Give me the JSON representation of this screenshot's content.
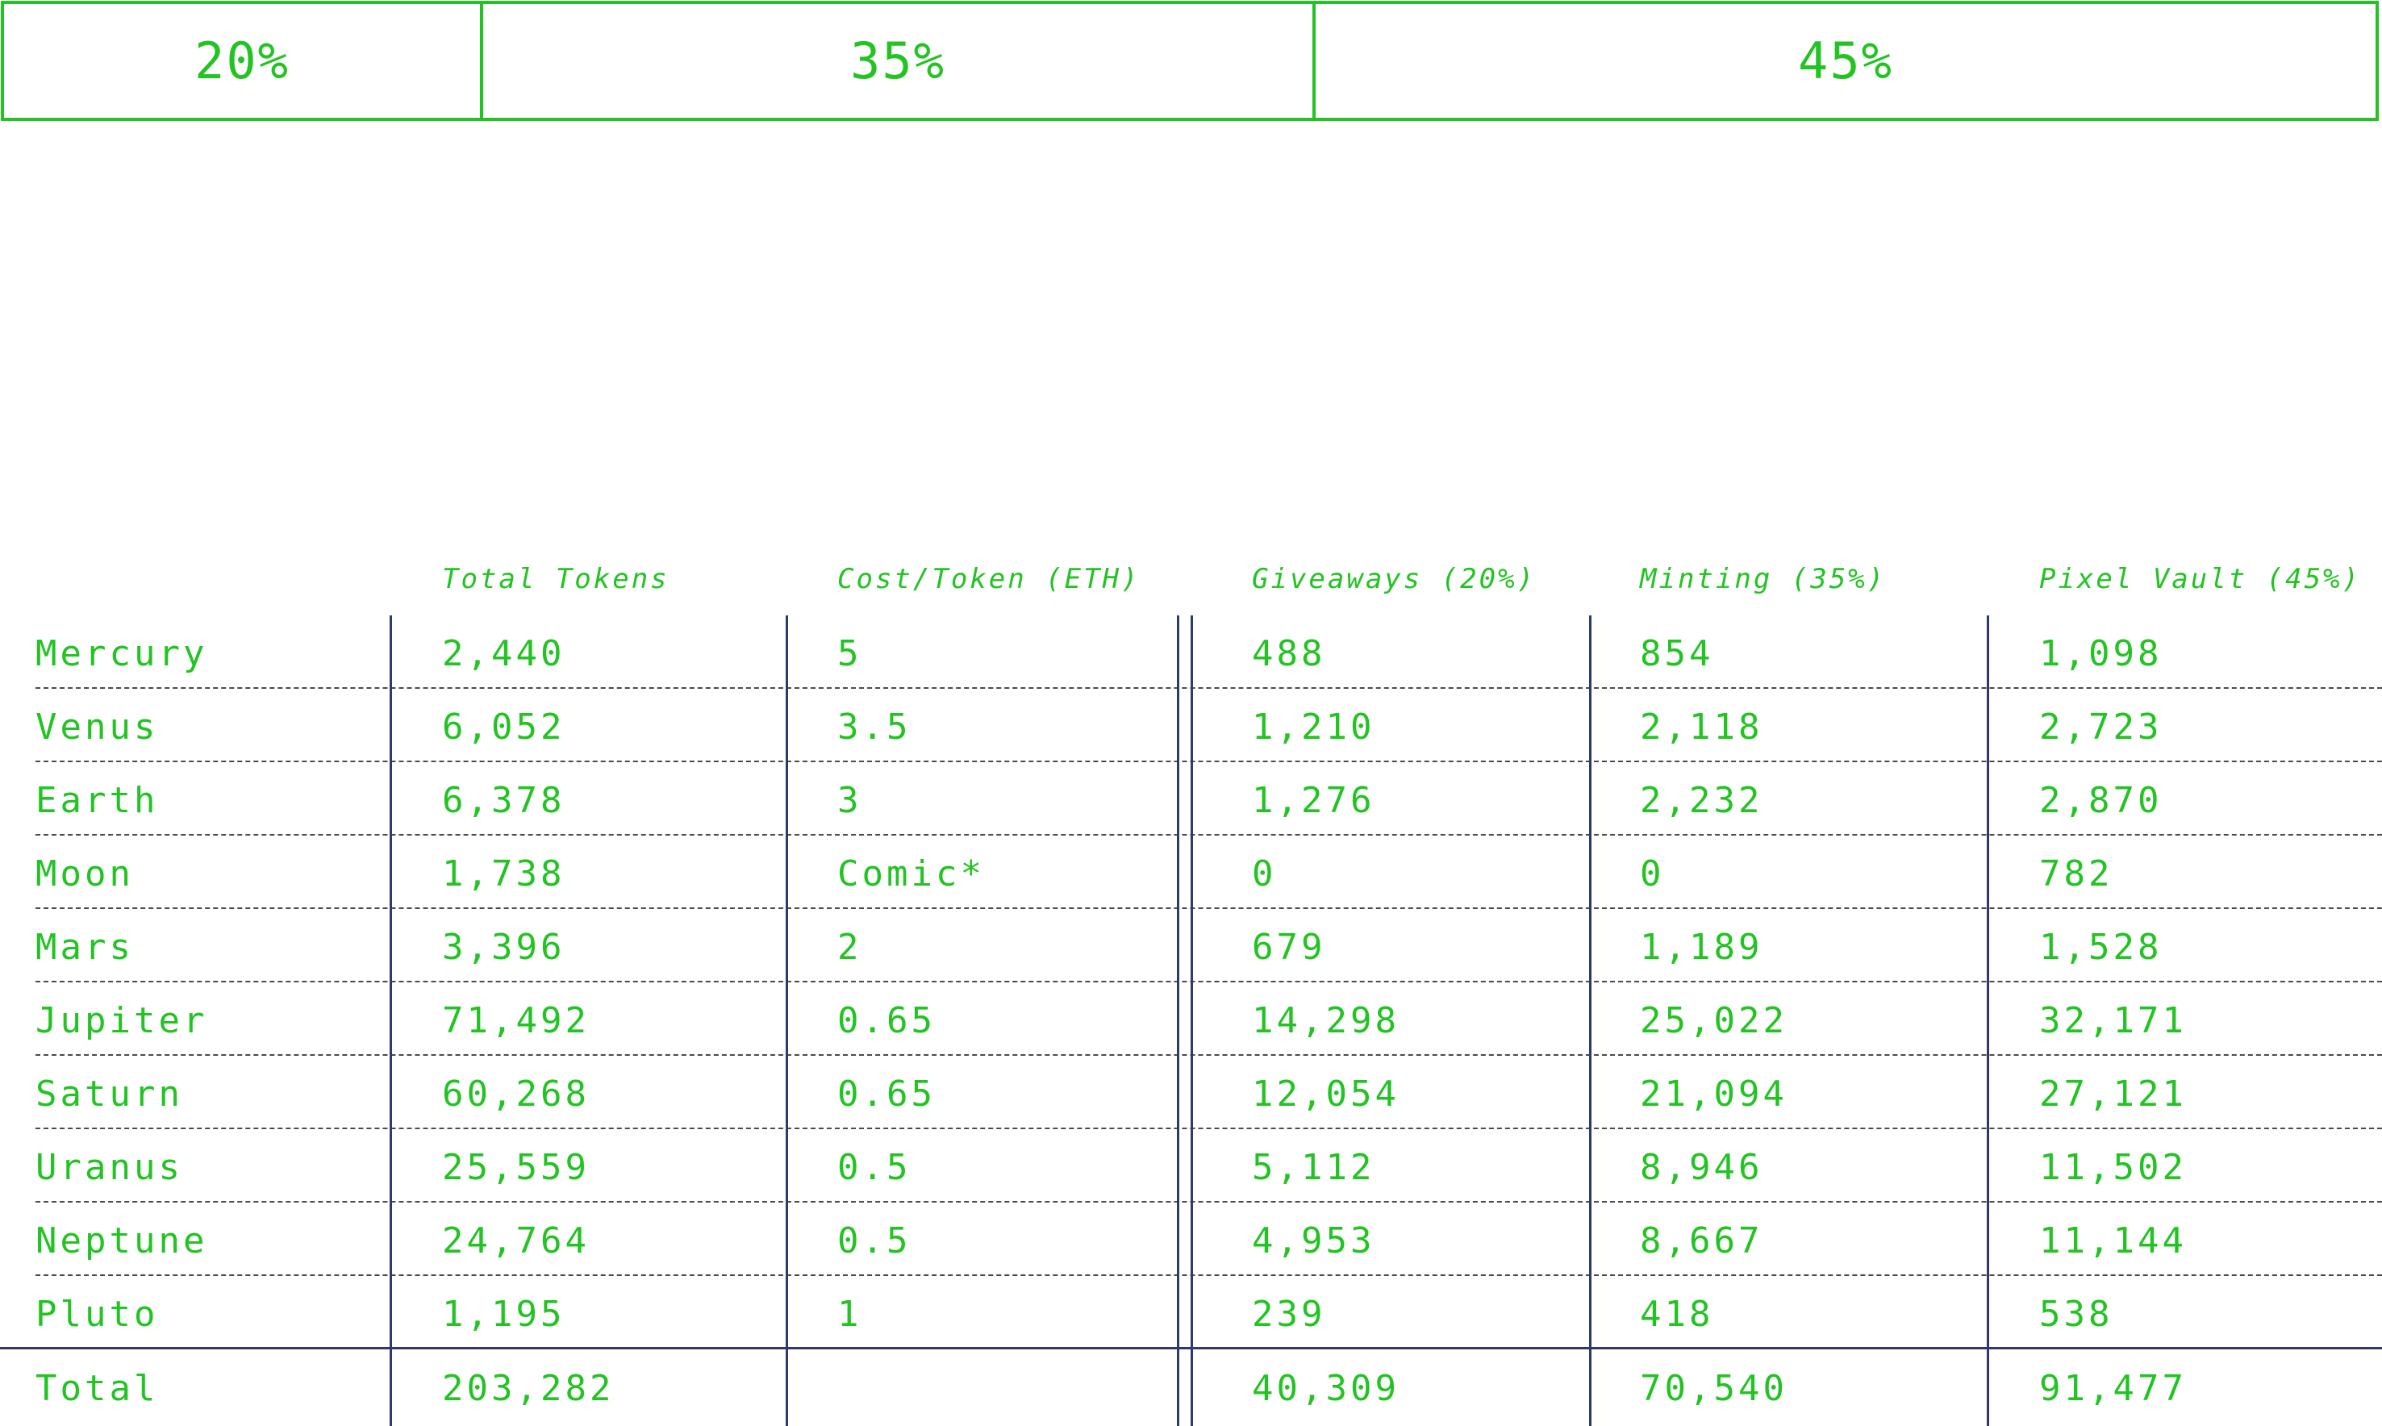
{
  "percent_bar": [
    {
      "label": "20%",
      "value": 20
    },
    {
      "label": "35%",
      "value": 35
    },
    {
      "label": "45%",
      "value": 45
    }
  ],
  "table": {
    "headers": [
      "",
      "Total Tokens",
      "Cost/Token (ETH)",
      "Giveaways (20%)",
      "Minting (35%)",
      "Pixel Vault (45%)"
    ],
    "rows": [
      [
        "Mercury",
        "2,440",
        "5",
        "488",
        "854",
        "1,098"
      ],
      [
        "Venus",
        "6,052",
        "3.5",
        "1,210",
        "2,118",
        "2,723"
      ],
      [
        "Earth",
        "6,378",
        "3",
        "1,276",
        "2,232",
        "2,870"
      ],
      [
        "Moon",
        "1,738",
        "Comic*",
        "0",
        "0",
        "782"
      ],
      [
        "Mars",
        "3,396",
        "2",
        "679",
        "1,189",
        "1,528"
      ],
      [
        "Jupiter",
        "71,492",
        "0.65",
        "14,298",
        "25,022",
        "32,171"
      ],
      [
        "Saturn",
        "60,268",
        "0.65",
        "12,054",
        "21,094",
        "27,121"
      ],
      [
        "Uranus",
        "25,559",
        "0.5",
        "5,112",
        "8,946",
        "11,502"
      ],
      [
        "Neptune",
        "24,764",
        "0.5",
        "4,953",
        "8,667",
        "11,144"
      ],
      [
        "Pluto",
        "1,195",
        "1",
        "239",
        "418",
        "538"
      ]
    ],
    "total": [
      "Total",
      "203,282",
      "",
      "40,309",
      "70,540",
      "91,477"
    ]
  },
  "colors": {
    "accent": "#22c322",
    "rule": "#2d3a6b",
    "dashed": "#4a4a4a"
  }
}
